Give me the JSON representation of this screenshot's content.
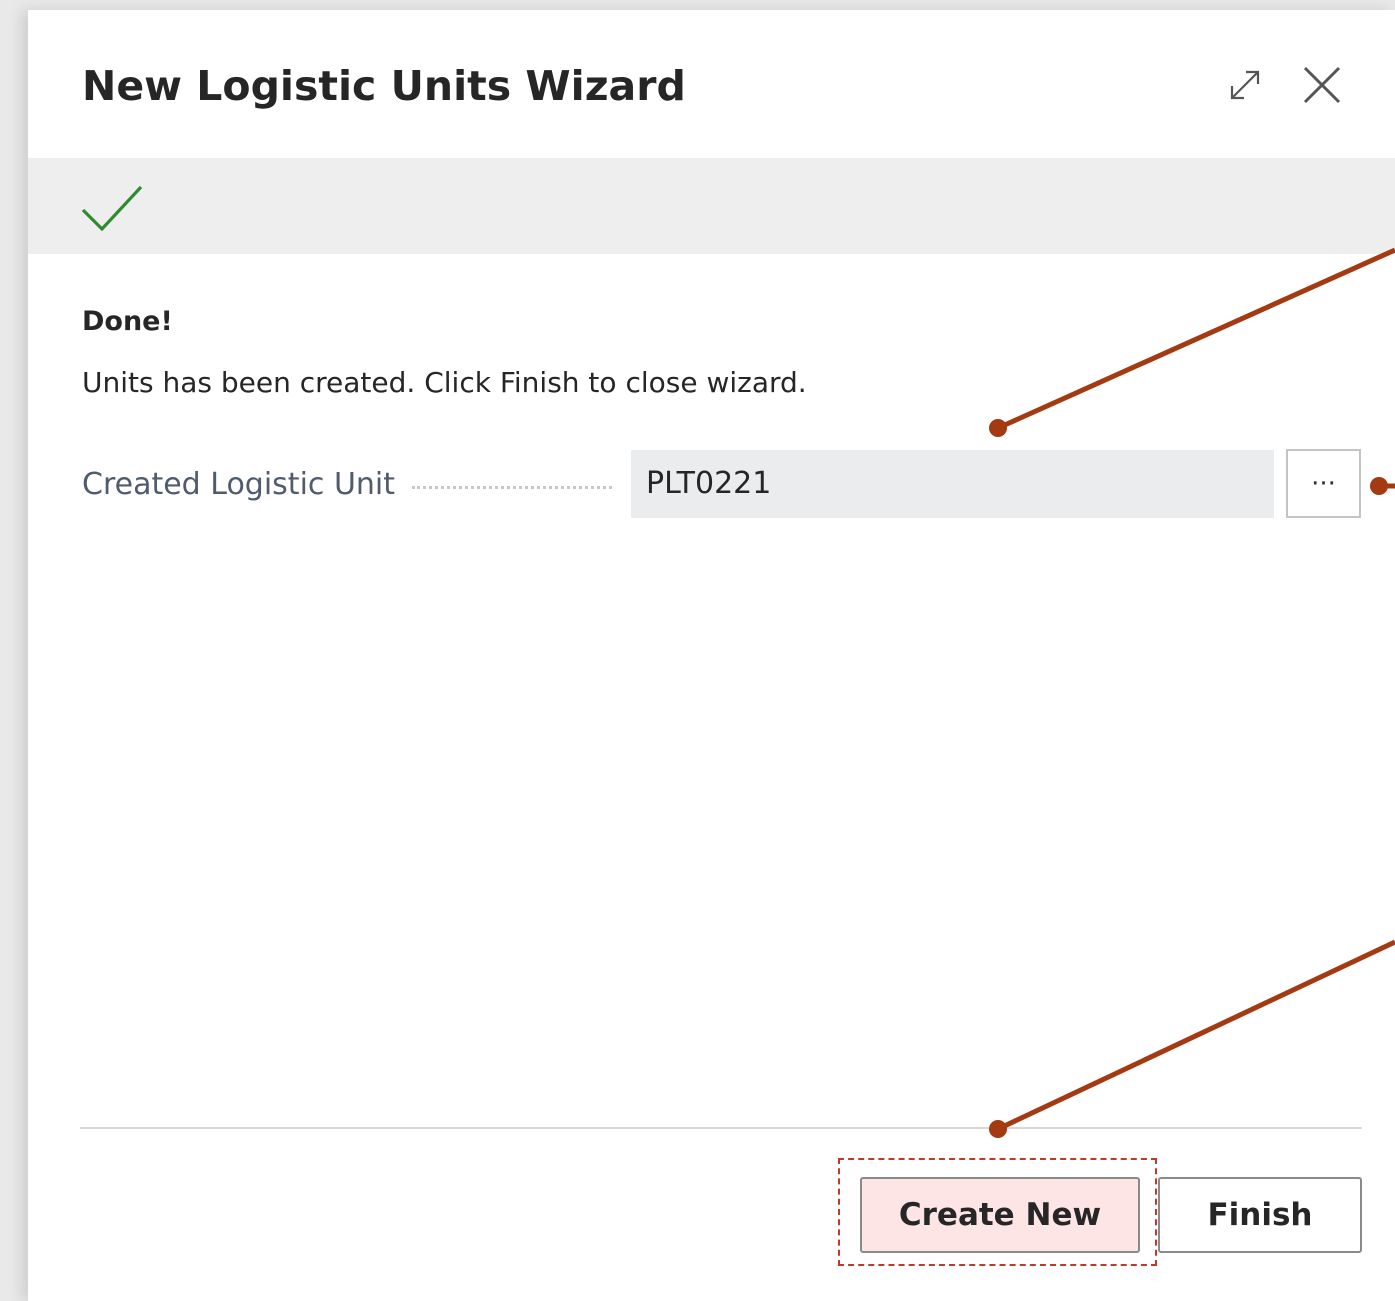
{
  "dialog": {
    "title": "New Logistic Units Wizard",
    "icons": {
      "expand": "expand-icon",
      "close": "close-icon",
      "status": "checkmark-icon"
    }
  },
  "content": {
    "heading": "Done!",
    "message": "Units has been created. Click Finish to close wizard.",
    "field": {
      "label": "Created Logistic Unit",
      "value": "PLT0221",
      "assist_label": "···"
    }
  },
  "footer": {
    "create_new_label": "Create New",
    "finish_label": "Finish"
  },
  "colors": {
    "accent_check": "#2e8b2e",
    "callout": "#a33a12",
    "highlight_border": "#c0392b",
    "highlight_fill": "#fde5e5"
  }
}
